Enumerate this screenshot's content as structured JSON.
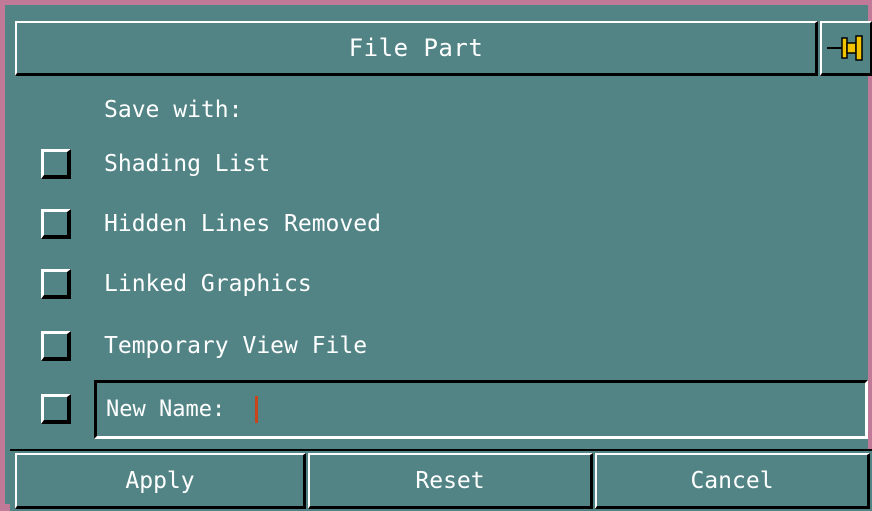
{
  "dialog": {
    "title": "File Part",
    "pin_icon": "pin-icon"
  },
  "save_with": {
    "label": "Save with:",
    "options": [
      {
        "label": "Shading List",
        "checked": false
      },
      {
        "label": "Hidden Lines Removed",
        "checked": false
      },
      {
        "label": "Linked Graphics",
        "checked": false
      },
      {
        "label": "Temporary View File",
        "checked": false
      }
    ]
  },
  "new_name": {
    "label": "New Name:",
    "value": "",
    "checked": false
  },
  "actions": {
    "apply_label": "Apply",
    "reset_label": "Reset",
    "cancel_label": "Cancel"
  },
  "colors": {
    "panel": "#528486",
    "frame": "#c07a97",
    "caret": "#c8441a",
    "pin": "#f2c400"
  }
}
